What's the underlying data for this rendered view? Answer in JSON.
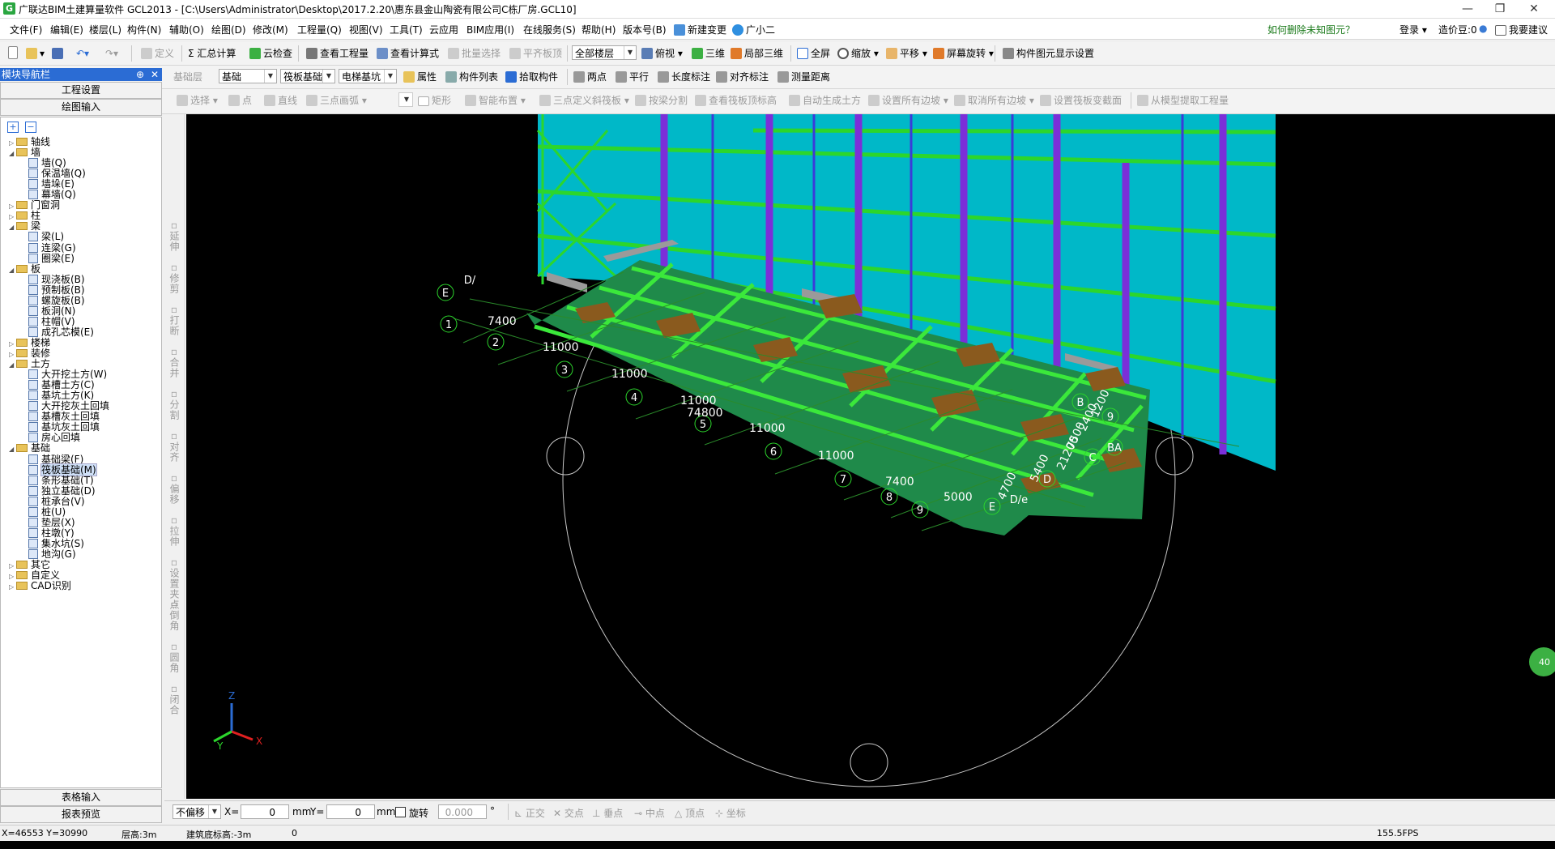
{
  "window": {
    "app_icon": "G",
    "title": "广联达BIM土建算量软件 GCL2013 - [C:\\Users\\Administrator\\Desktop\\2017.2.20\\惠东县金山陶瓷有限公司C栋厂房.GCL10]",
    "min": "—",
    "max": "❐",
    "close": "✕"
  },
  "menu": [
    "文件(F)",
    "编辑(E)",
    "楼层(L)",
    "构件(N)",
    "辅助(O)",
    "绘图(D)",
    "修改(M)",
    "工程量(Q)",
    "视图(V)",
    "工具(T)",
    "云应用",
    "BIM应用(I)",
    "在线服务(S)",
    "帮助(H)",
    "版本号(B)",
    "新建变更",
    "广小二"
  ],
  "menu_right": {
    "help_link": "如何删除未知图元？",
    "login": "登录",
    "price_beans": "造价豆:0",
    "feedback": "我要建议"
  },
  "toolbar1": {
    "define": "定义",
    "summary": "Σ 汇总计算",
    "cloud_check": "云检查",
    "view_quantity": "查看工程量",
    "view_formula": "查看计算式",
    "batch_select": "批量选择",
    "flush_top": "平齐板顶",
    "floor_select": "全部楼层",
    "view_dir": "俯视",
    "three_d": "三维",
    "local_3d": "局部三维",
    "fullscreen": "全屏",
    "zoom": "缩放",
    "pan": "平移",
    "rotate": "屏幕旋转",
    "display_settings": "构件图元显示设置"
  },
  "toolbar2": {
    "layer_label": "基础层",
    "layer": "基础",
    "type": "筏板基础",
    "component": "电梯基坑",
    "properties": "属性",
    "list": "构件列表",
    "pick": "拾取构件",
    "two_point": "两点",
    "parallel": "平行",
    "length_dim": "长度标注",
    "align_dim": "对齐标注",
    "measure": "测量距离"
  },
  "toolbar3": {
    "select": "选择",
    "point": "点",
    "line": "直线",
    "arc": "三点画弧",
    "rect": "矩形",
    "smart": "智能布置",
    "three_point_slope": "三点定义斜筏板",
    "split_by_beam": "按梁分割",
    "view_raft_elev": "查看筏板顶标高",
    "auto_earth": "自动生成土方",
    "set_all_edges": "设置所有边坡",
    "cancel_all_edges": "取消所有边坡",
    "set_raft_section": "设置筏板变截面",
    "extract_from_model": "从模型提取工程量"
  },
  "nav": {
    "header": "模块导航栏",
    "pin": "⊕",
    "close": "✕",
    "project_settings": "工程设置",
    "draw_input": "绘图输入",
    "table_input": "表格输入",
    "report_preview": "报表预览",
    "expand": "+",
    "collapse": "−"
  },
  "tree": [
    {
      "d": 0,
      "t": "轴线",
      "f": 1,
      "c": 0
    },
    {
      "d": 0,
      "t": "墙",
      "f": 1,
      "o": 1
    },
    {
      "d": 1,
      "t": "墙(Q)"
    },
    {
      "d": 1,
      "t": "保温墙(Q)"
    },
    {
      "d": 1,
      "t": "墙垛(E)"
    },
    {
      "d": 1,
      "t": "幕墙(Q)"
    },
    {
      "d": 0,
      "t": "门窗洞",
      "f": 1,
      "c": 0
    },
    {
      "d": 0,
      "t": "柱",
      "f": 1,
      "c": 0
    },
    {
      "d": 0,
      "t": "梁",
      "f": 1,
      "o": 1
    },
    {
      "d": 1,
      "t": "梁(L)"
    },
    {
      "d": 1,
      "t": "连梁(G)"
    },
    {
      "d": 1,
      "t": "圈梁(E)"
    },
    {
      "d": 0,
      "t": "板",
      "f": 1,
      "o": 1
    },
    {
      "d": 1,
      "t": "现浇板(B)"
    },
    {
      "d": 1,
      "t": "预制板(B)"
    },
    {
      "d": 1,
      "t": "螺旋板(B)"
    },
    {
      "d": 1,
      "t": "板洞(N)"
    },
    {
      "d": 1,
      "t": "柱帽(V)"
    },
    {
      "d": 1,
      "t": "成孔芯模(E)"
    },
    {
      "d": 0,
      "t": "楼梯",
      "f": 1,
      "c": 0
    },
    {
      "d": 0,
      "t": "装修",
      "f": 1,
      "c": 0
    },
    {
      "d": 0,
      "t": "土方",
      "f": 1,
      "o": 1
    },
    {
      "d": 1,
      "t": "大开挖土方(W)"
    },
    {
      "d": 1,
      "t": "基槽土方(C)"
    },
    {
      "d": 1,
      "t": "基坑土方(K)"
    },
    {
      "d": 1,
      "t": "大开挖灰土回填"
    },
    {
      "d": 1,
      "t": "基槽灰土回填"
    },
    {
      "d": 1,
      "t": "基坑灰土回填"
    },
    {
      "d": 1,
      "t": "房心回填"
    },
    {
      "d": 0,
      "t": "基础",
      "f": 1,
      "o": 1
    },
    {
      "d": 1,
      "t": "基础梁(F)"
    },
    {
      "d": 1,
      "t": "筏板基础(M)",
      "sel": 1
    },
    {
      "d": 1,
      "t": "条形基础(T)"
    },
    {
      "d": 1,
      "t": "独立基础(D)"
    },
    {
      "d": 1,
      "t": "桩承台(V)"
    },
    {
      "d": 1,
      "t": "桩(U)"
    },
    {
      "d": 1,
      "t": "垫层(X)"
    },
    {
      "d": 1,
      "t": "柱墩(Y)"
    },
    {
      "d": 1,
      "t": "集水坑(S)"
    },
    {
      "d": 1,
      "t": "地沟(G)"
    },
    {
      "d": 0,
      "t": "其它",
      "f": 1,
      "c": 0
    },
    {
      "d": 0,
      "t": "自定义",
      "f": 1,
      "c": 0
    },
    {
      "d": 0,
      "t": "CAD识别",
      "f": 1,
      "c": 0
    }
  ],
  "vtools": [
    "延伸",
    "修剪",
    "打断",
    "合并",
    "分割",
    "对齐",
    "偏移",
    "拉伸",
    "设置夹点",
    "倒角",
    "圆角",
    "闭合"
  ],
  "viewport": {
    "axis_numbers": [
      "1",
      "2",
      "3",
      "4",
      "5",
      "6",
      "7",
      "8",
      "9"
    ],
    "axis_letters": [
      "E",
      "D/",
      "B",
      "C",
      "BA",
      "D",
      "D/e",
      "E",
      "9"
    ],
    "dims_bottom": [
      "7400",
      "11000",
      "11000",
      "11000",
      "74800",
      "11000",
      "11000",
      "7400",
      "5000"
    ],
    "dims_right": [
      "2400",
      "1200",
      "7500",
      "21200",
      "5400",
      "4700"
    ],
    "axes_gizmo": {
      "z": "Z",
      "x": "X",
      "y": "Y"
    },
    "side_badge": "40"
  },
  "coords": {
    "offset": "不偏移",
    "x_label": "X=",
    "x_value": "0",
    "mm1": "mm",
    "y_label": "Y=",
    "y_value": "0",
    "mm2": "mm",
    "rotate": "旋转",
    "rotate_value": "0.000",
    "deg": "°",
    "ortho": "正交",
    "intersect": "交点",
    "perp": "垂点",
    "mid": "中点",
    "vertex": "顶点",
    "coord": "坐标"
  },
  "status": {
    "xy": "X=46553 Y=30990",
    "floor_height": "层高:3m",
    "base_elev": "建筑底标高:-3m",
    "zero": "0",
    "fps": "155.5FPS"
  }
}
